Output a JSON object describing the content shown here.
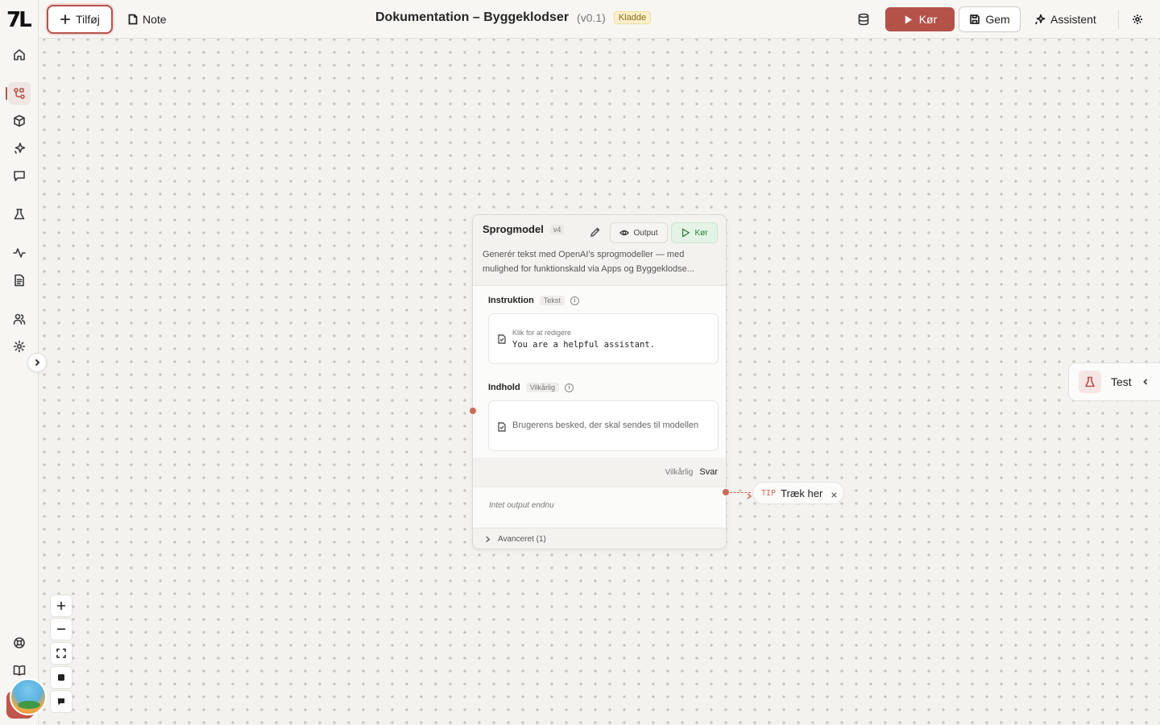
{
  "header": {
    "add_label": "Tilføj",
    "note_label": "Note",
    "title": "Dokumentation – Byggeklodser",
    "version": "(v0.1)",
    "status_badge": "Kladde",
    "run_label": "Kør",
    "save_label": "Gem",
    "assistant_label": "Assistent"
  },
  "sidebar": {
    "logo": "7L",
    "items": [
      {
        "icon": "home-icon"
      },
      {
        "icon": "workflow-icon",
        "active": true
      },
      {
        "icon": "cube-icon"
      },
      {
        "icon": "sparkle-icon"
      },
      {
        "icon": "chat-icon"
      },
      {
        "icon": "flask-icon"
      },
      {
        "icon": "activity-icon"
      },
      {
        "icon": "document-icon"
      },
      {
        "icon": "users-icon"
      },
      {
        "icon": "gear-icon"
      },
      {
        "icon": "help-icon"
      },
      {
        "icon": "book-icon"
      }
    ]
  },
  "node": {
    "title": "Sprogmodel",
    "version": "v4",
    "output_label": "Output",
    "run_label": "Kør",
    "description": "Generér tekst med OpenAI's sprogmodeller — med mulighed for funktionskald via Apps og Byggeklodse...",
    "instruction": {
      "label": "Instruktion",
      "tag": "Tekst",
      "hint": "Klik for at redigere",
      "value": "You are a helpful assistant."
    },
    "content": {
      "label": "Indhold",
      "tag": "Vilkårlig",
      "placeholder": "Brugerens besked, der skal sendes til modellen"
    },
    "output": {
      "tag": "Vilkårlig",
      "label": "Svar",
      "empty_text": "Intet output endnu"
    },
    "advanced_label": "Avanceret (1)"
  },
  "tip": {
    "tag": "TIP",
    "text": "Træk her"
  },
  "test_panel": {
    "label": "Test"
  },
  "colors": {
    "accent": "#b4524a",
    "handle": "#cd6a55",
    "run_green": "#2f7d3e",
    "badge_bg": "#fbf0c9"
  }
}
